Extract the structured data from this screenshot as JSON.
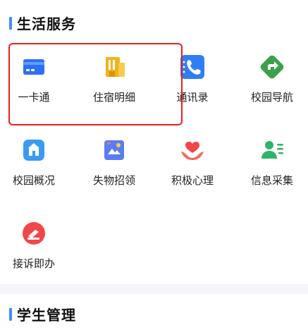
{
  "life_services": {
    "title": "生活服务",
    "items": [
      {
        "label": "一卡通",
        "icon": "card-icon"
      },
      {
        "label": "住宿明细",
        "icon": "building-icon"
      },
      {
        "label": "通讯录",
        "icon": "phone-icon"
      },
      {
        "label": "校园导航",
        "icon": "navigation-icon"
      },
      {
        "label": "校园概况",
        "icon": "campus-icon"
      },
      {
        "label": "失物招领",
        "icon": "lost-found-icon"
      },
      {
        "label": "积极心理",
        "icon": "heart-hands-icon"
      },
      {
        "label": "信息采集",
        "icon": "user-info-icon"
      },
      {
        "label": "接诉即办",
        "icon": "complaint-icon"
      }
    ]
  },
  "student_management": {
    "title": "学生管理"
  },
  "colors": {
    "accent": "#3f8cff",
    "highlight_border": "#ea1e1e"
  }
}
